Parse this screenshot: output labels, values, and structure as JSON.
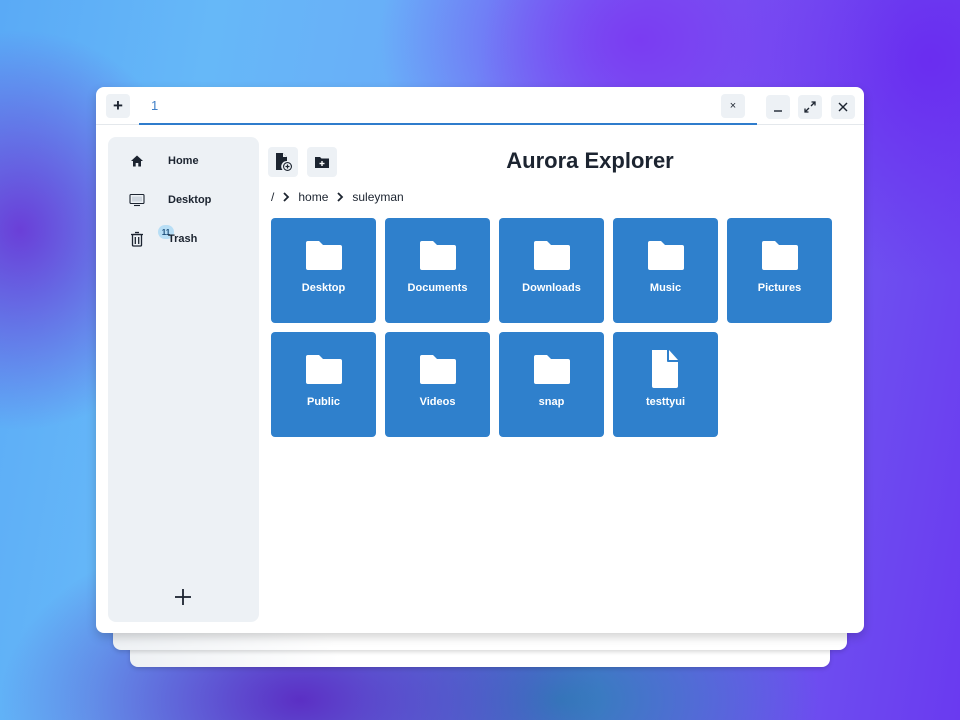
{
  "window": {
    "new_tab_label": "+",
    "tabs": [
      {
        "label": "1",
        "active": true,
        "close_label": "×"
      }
    ],
    "controls": {
      "minimize": "minimize",
      "maximize": "maximize",
      "close": "close"
    }
  },
  "sidebar": {
    "items": [
      {
        "label": "Home",
        "icon": "home-icon"
      },
      {
        "label": "Desktop",
        "icon": "monitor-icon"
      },
      {
        "label": "Trash",
        "icon": "trash-icon",
        "badge": "11"
      }
    ],
    "add_label": "+"
  },
  "toolbar": {
    "new_file": "new-file",
    "new_folder": "new-folder"
  },
  "header": {
    "title": "Aurora Explorer"
  },
  "breadcrumb": {
    "root": "/",
    "segments": [
      "home",
      "suleyman"
    ]
  },
  "files": [
    {
      "name": "Desktop",
      "type": "folder"
    },
    {
      "name": "Documents",
      "type": "folder"
    },
    {
      "name": "Downloads",
      "type": "folder"
    },
    {
      "name": "Music",
      "type": "folder"
    },
    {
      "name": "Pictures",
      "type": "folder"
    },
    {
      "name": "Public",
      "type": "folder"
    },
    {
      "name": "Videos",
      "type": "folder"
    },
    {
      "name": "snap",
      "type": "folder"
    },
    {
      "name": "testtyui",
      "type": "file"
    }
  ],
  "colors": {
    "accent": "#2f80cc",
    "tab_underline": "#2f7ccc",
    "sidebar_bg": "#edf1f5",
    "text": "#1c2430"
  }
}
